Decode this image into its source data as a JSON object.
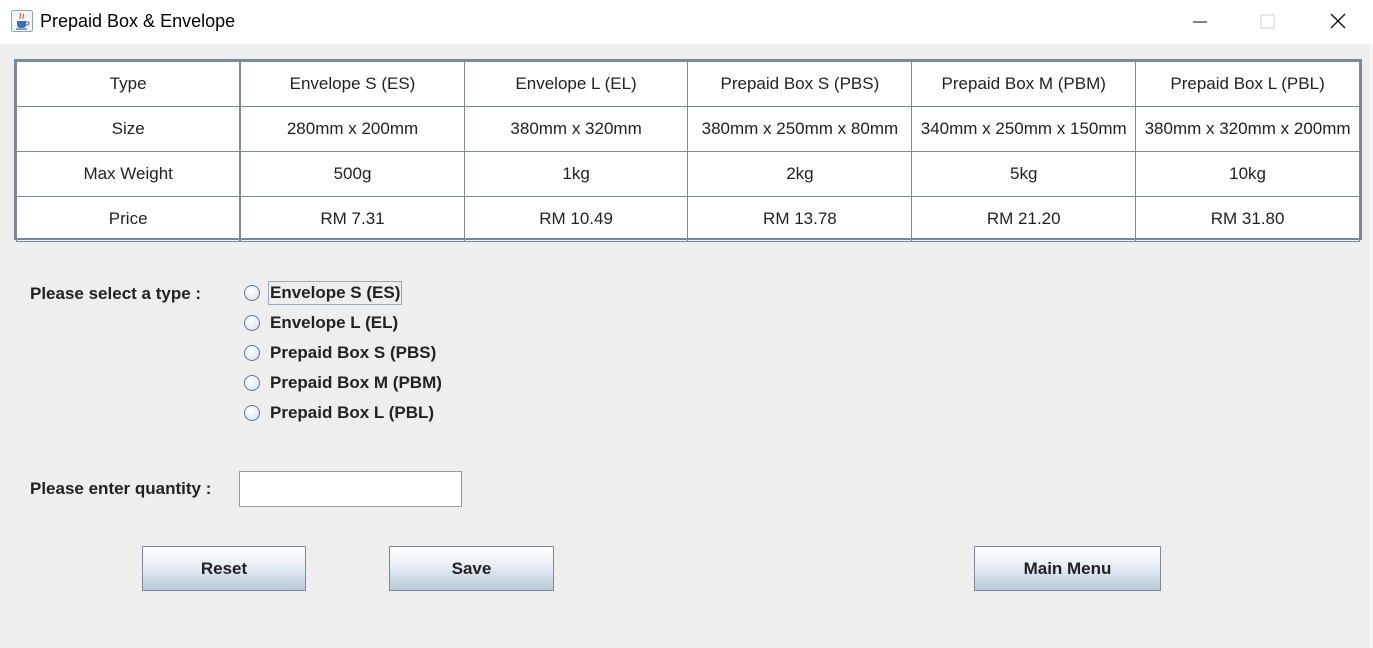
{
  "window": {
    "title": "Prepaid Box & Envelope",
    "icon": "java-cup-icon"
  },
  "table": {
    "headers": [
      "Type",
      "Envelope S (ES)",
      "Envelope L (EL)",
      "Prepaid Box S (PBS)",
      "Prepaid Box M (PBM)",
      "Prepaid Box L (PBL)"
    ],
    "rows": [
      [
        "Size",
        "280mm x 200mm",
        "380mm x 320mm",
        "380mm x 250mm x 80mm",
        "340mm x 250mm x 150mm",
        "380mm x 320mm x 200mm"
      ],
      [
        "Max Weight",
        "500g",
        "1kg",
        "2kg",
        "5kg",
        "10kg"
      ],
      [
        "Price",
        "RM 7.31",
        "RM 10.49",
        "RM 13.78",
        "RM 21.20",
        "RM 31.80"
      ]
    ]
  },
  "form": {
    "type_label": "Please select a type :",
    "type_options": [
      "Envelope S (ES)",
      "Envelope L (EL)",
      "Prepaid Box S (PBS)",
      "Prepaid Box M (PBM)",
      "Prepaid Box L (PBL)"
    ],
    "quantity_label": "Please enter quantity :",
    "quantity_value": ""
  },
  "buttons": {
    "reset": "Reset",
    "save": "Save",
    "main_menu": "Main Menu"
  }
}
